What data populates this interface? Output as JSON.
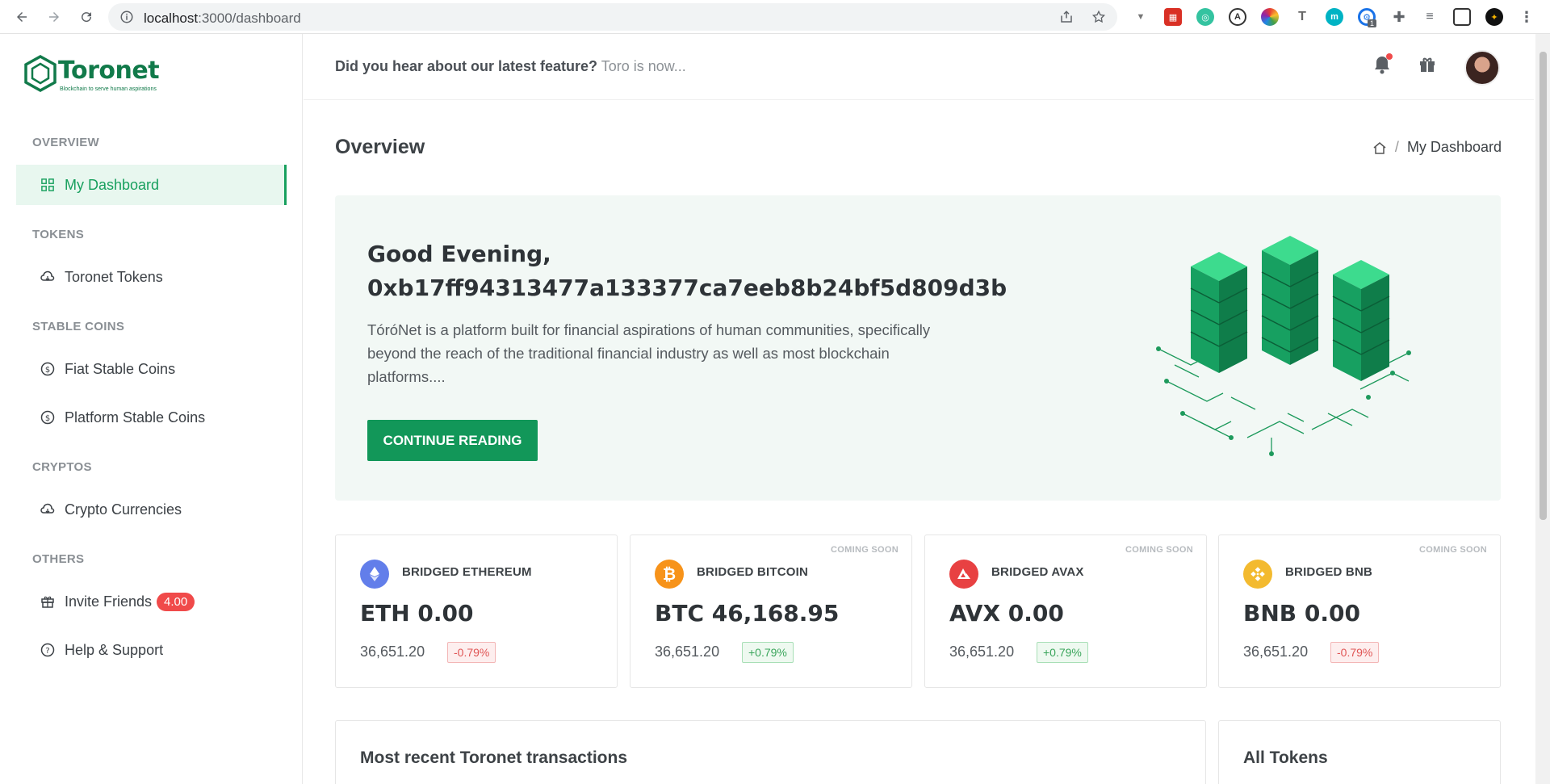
{
  "browser": {
    "url_host": "localhost",
    "url_path": ":3000/dashboard",
    "extension_badge": "1"
  },
  "brand": {
    "name": "Toronet",
    "tagline": "Blockchain to serve human aspirations",
    "primary_color": "#129759"
  },
  "sidebar": {
    "sections": [
      {
        "title": "OVERVIEW"
      },
      {
        "title": "TOKENS"
      },
      {
        "title": "STABLE COINS"
      },
      {
        "title": "CRYPTOS"
      },
      {
        "title": "OTHERS"
      }
    ],
    "items": [
      {
        "label": "My Dashboard",
        "icon": "grid-icon",
        "active": true
      },
      {
        "label": "Toronet Tokens",
        "icon": "cloud-icon"
      },
      {
        "label": "Fiat Stable Coins",
        "icon": "dollar-circle-icon"
      },
      {
        "label": "Platform Stable Coins",
        "icon": "dollar-circle-icon"
      },
      {
        "label": "Crypto Currencies",
        "icon": "cloud-icon"
      },
      {
        "label": "Invite Friends",
        "icon": "gift-icon",
        "badge": "4.00"
      },
      {
        "label": "Help & Support",
        "icon": "question-circle-icon"
      }
    ]
  },
  "header": {
    "announcement_bold": "Did you hear about our latest feature?",
    "announcement_rest": "Toro is now..."
  },
  "main": {
    "title": "Overview",
    "breadcrumb": "My Dashboard",
    "hero": {
      "greeting": "Good Evening,",
      "address": "0xb17ff94313477a133377ca7eeb8b24bf5d809d3b",
      "description": "TóróNet is a platform built for financial aspirations of human communities, specifically beyond the reach of the traditional financial industry as well as most blockchain platforms....",
      "button": "CONTINUE READING"
    },
    "tokens": [
      {
        "name": "BRIDGED ETHEREUM",
        "value": "ETH 0.00",
        "sub": "36,651.20",
        "change": "-0.79%",
        "trend": "neg",
        "coming_soon": "",
        "color": "#627eea"
      },
      {
        "name": "BRIDGED BITCOIN",
        "value": "BTC 46,168.95",
        "sub": "36,651.20",
        "change": "+0.79%",
        "trend": "pos",
        "coming_soon": "COMING SOON",
        "color": "#f7931a"
      },
      {
        "name": "BRIDGED AVAX",
        "value": "AVX 0.00",
        "sub": "36,651.20",
        "change": "+0.79%",
        "trend": "pos",
        "coming_soon": "COMING SOON",
        "color": "#e84142"
      },
      {
        "name": "BRIDGED BNB",
        "value": "BNB 0.00",
        "sub": "36,651.20",
        "change": "-0.79%",
        "trend": "neg",
        "coming_soon": "COMING SOON",
        "color": "#f3ba2f"
      }
    ],
    "recent_title": "Most recent Toronet transactions",
    "all_tokens_title": "All Tokens"
  }
}
